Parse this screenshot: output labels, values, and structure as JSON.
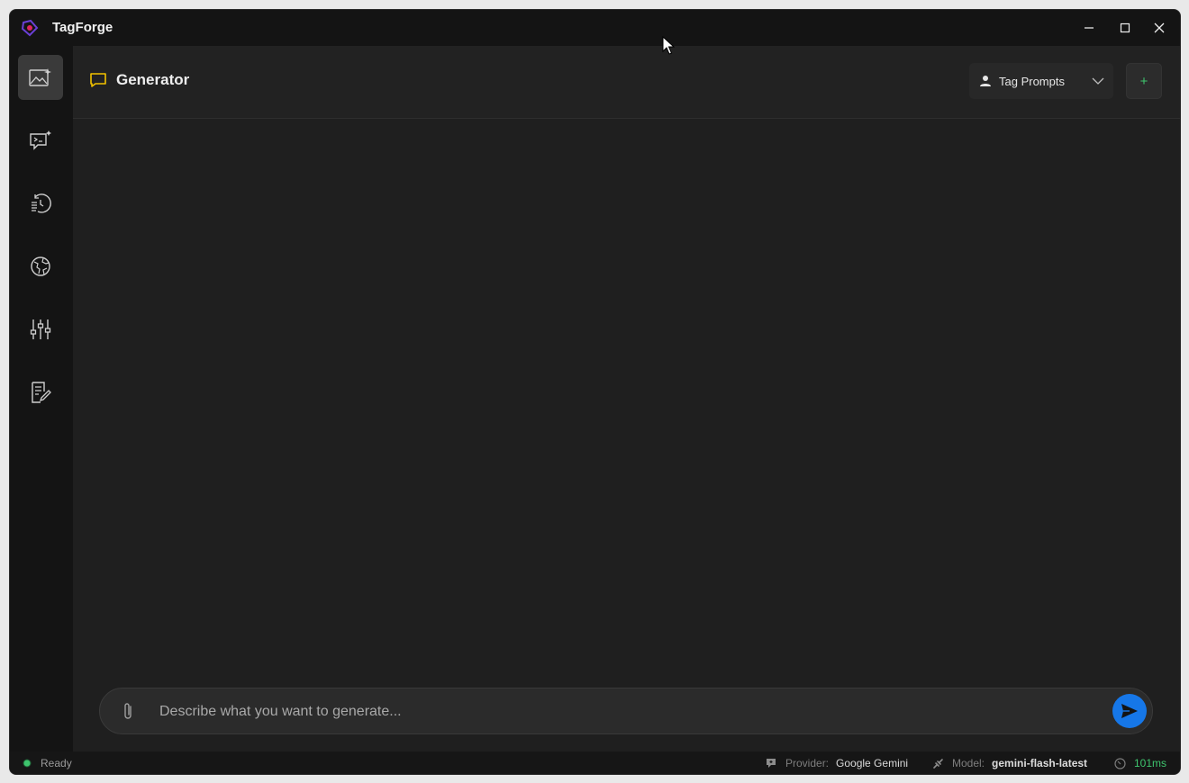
{
  "app": {
    "title": "TagForge"
  },
  "header": {
    "title": "Generator",
    "profile_select": "Tag Prompts",
    "add_button": "+"
  },
  "sidebar": {
    "items": [
      {
        "name": "image-generator",
        "icon": "image-sparkle-icon",
        "active": true
      },
      {
        "name": "chat",
        "icon": "chat-sparkle-icon",
        "active": false
      },
      {
        "name": "history",
        "icon": "history-icon",
        "active": false
      },
      {
        "name": "providers",
        "icon": "globe-icon",
        "active": false
      },
      {
        "name": "settings",
        "icon": "sliders-icon",
        "active": false
      },
      {
        "name": "templates",
        "icon": "edit-document-icon",
        "active": false
      }
    ]
  },
  "composer": {
    "placeholder": "Describe what you want to generate...",
    "value": ""
  },
  "status": {
    "state": "Ready",
    "provider_label": "Provider:",
    "provider_value": "Google Gemini",
    "model_label": "Model:",
    "model_value": "gemini-flash-latest",
    "latency": "101ms"
  },
  "colors": {
    "accent": "#1677e8",
    "title_icon": "#f2c200",
    "status_ok": "#3ec46d",
    "background": "#1f1f1f"
  }
}
